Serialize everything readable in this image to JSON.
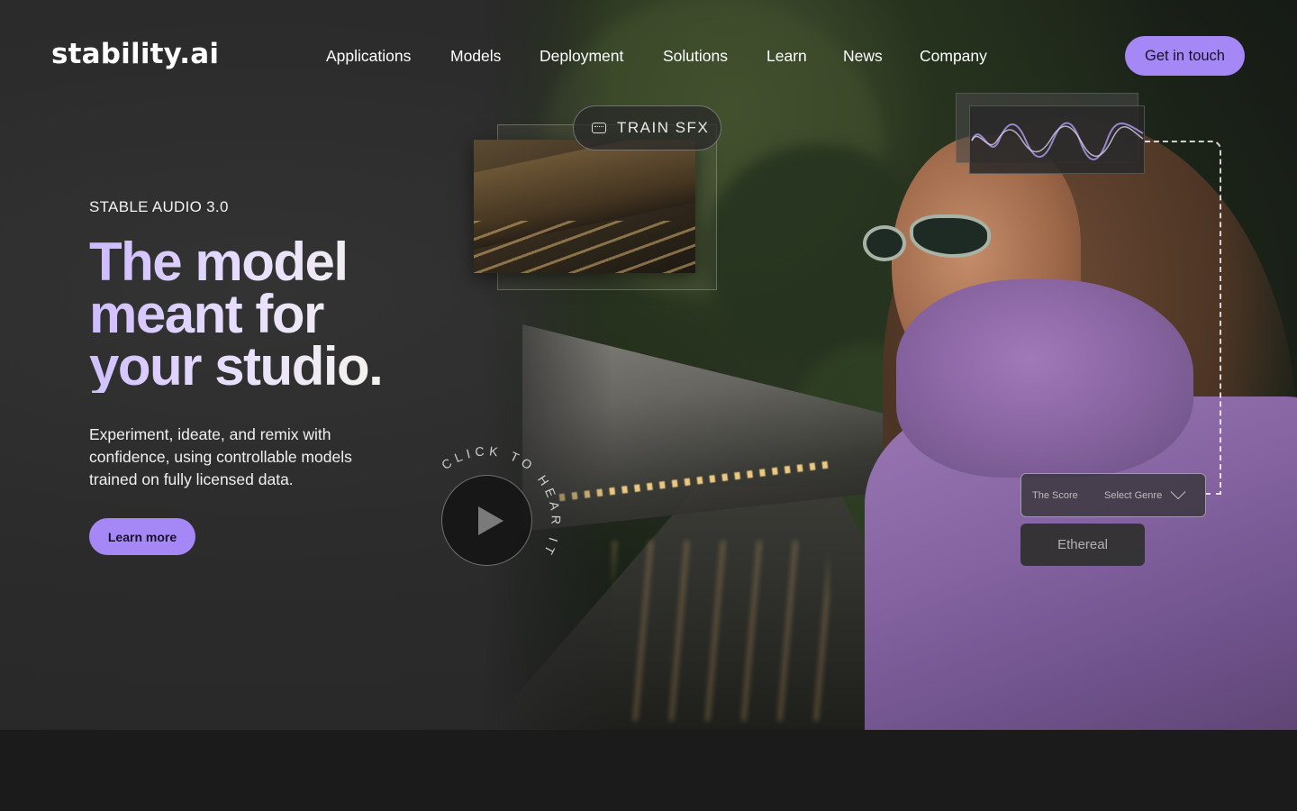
{
  "brand": {
    "logo": "stability.ai"
  },
  "nav": {
    "items": [
      "Applications",
      "Models",
      "Deployment",
      "Solutions",
      "Learn",
      "News",
      "Company"
    ],
    "cta": "Get in touch"
  },
  "hero": {
    "eyebrow": "STABLE AUDIO 3.0",
    "headline_line1": "The model",
    "headline_line2": "meant for",
    "headline_line3": "your studio.",
    "subcopy": "Experiment, ideate, and remix with confidence, using controllable models trained on fully licensed data.",
    "button": "Learn more"
  },
  "overlays": {
    "sfx_pill": "TRAIN SFX",
    "play_caption": "CLICK TO HEAR IT",
    "score_label": "The Score",
    "genre_placeholder": "Select Genre",
    "genre_value": "Ethereal"
  },
  "colors": {
    "accent": "#a588f5",
    "background": "#2a2a2a",
    "footer": "#1b1b1b"
  }
}
